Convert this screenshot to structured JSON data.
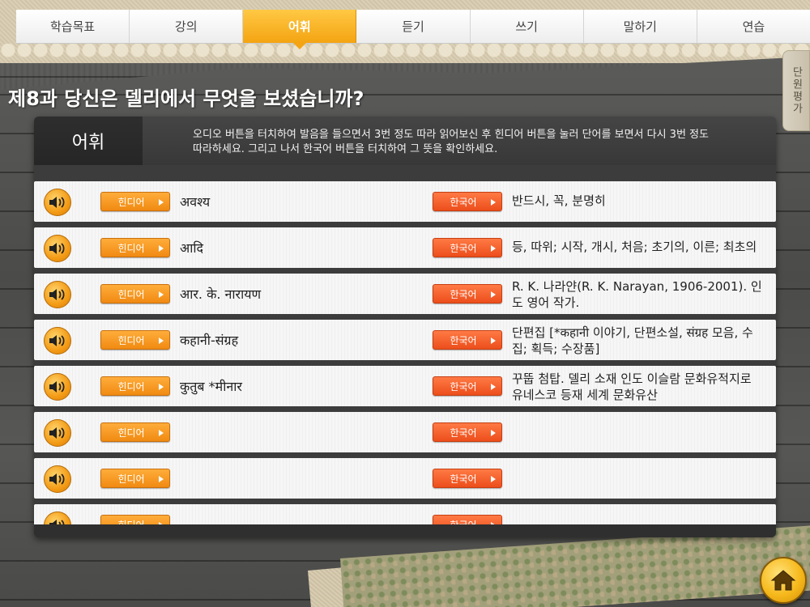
{
  "tabs": [
    {
      "label": "학습목표",
      "active": false
    },
    {
      "label": "강의",
      "active": false
    },
    {
      "label": "어휘",
      "active": true
    },
    {
      "label": "듣기",
      "active": false
    },
    {
      "label": "쓰기",
      "active": false
    },
    {
      "label": "말하기",
      "active": false
    },
    {
      "label": "연습",
      "active": false
    }
  ],
  "side_tab": {
    "label": "단원평가"
  },
  "lesson": {
    "title": "제8과 당신은 델리에서 무엇을 보셨습니까?"
  },
  "panel": {
    "header_label": "어휘",
    "description": "오디오 버튼을 터치하여 발음을 들으면서 3번 정도 따라 읽어보신 후 힌디어 버튼을 눌러 단어를 보면서 다시 3번 정도 따라하세요. 그리고 나서 한국어 버튼을 터치하여 그 뜻을 확인하세요."
  },
  "buttons": {
    "hindi": "힌디어",
    "korean": "한국어"
  },
  "rows": [
    {
      "hindi": "अवश्य",
      "korean": "반드시, 꼭, 분명히"
    },
    {
      "hindi": "आदि",
      "korean": "등, 따위; 시작, 개시, 처음; 초기의, 이른; 최초의"
    },
    {
      "hindi": "आर. के. नारायण",
      "korean": "R. K. 나라얀(R. K. Narayan, 1906-2001). 인도 영어 작가."
    },
    {
      "hindi": "कहानी-संग्रह",
      "korean": "단편집 [*कहानी 이야기, 단편소설, संग्रह 모음, 수집; 획득; 수장품]"
    },
    {
      "hindi": "कुतुब *मीनार",
      "korean": "꾸뚭 첨탑. 델리 소재 인도 이슬람 문화유적지로 유네스코 등재 세계 문화유산"
    },
    {
      "hindi": "",
      "korean": ""
    },
    {
      "hindi": "",
      "korean": ""
    },
    {
      "hindi": "",
      "korean": ""
    }
  ],
  "colors": {
    "accent_tab": "#f4a412",
    "hindi_button": "#f08a12",
    "korean_button": "#ec4e1b"
  }
}
